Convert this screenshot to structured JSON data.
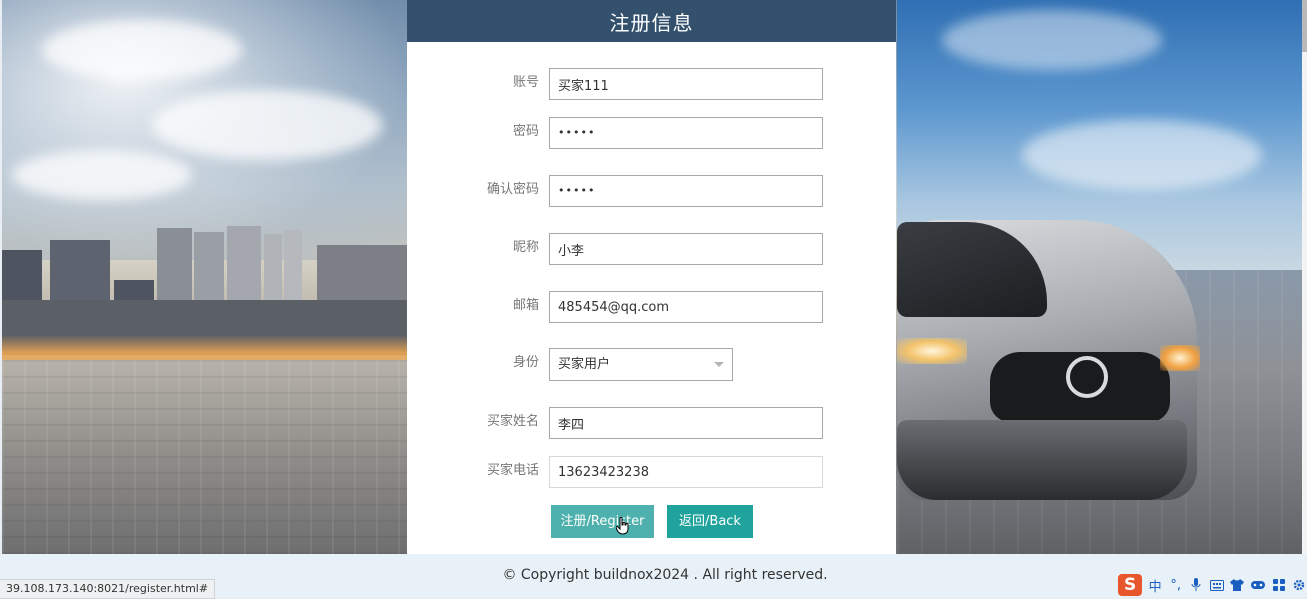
{
  "header": {
    "title": "注册信息"
  },
  "form": {
    "account": {
      "label": "账号",
      "value": "买家111"
    },
    "password": {
      "label": "密码",
      "value": "•••••"
    },
    "confirm_password": {
      "label": "确认密码",
      "value": "•••••"
    },
    "nickname": {
      "label": "昵称",
      "value": "小李"
    },
    "email": {
      "label": "邮箱",
      "value": "485454@qq.com"
    },
    "identity": {
      "label": "身份",
      "value": "买家用户"
    },
    "buyer_name": {
      "label": "买家姓名",
      "value": "李四"
    },
    "buyer_phone": {
      "label": "买家电话",
      "value": "13623423238"
    }
  },
  "buttons": {
    "register": "注册/Register",
    "back": "返回/Back"
  },
  "footer": {
    "copyright": "© Copyright buildnox2024 . All right reserved."
  },
  "status_bar": {
    "url": "39.108.173.140:8021/register.html#"
  },
  "ime": {
    "logo": "S",
    "mode": "中",
    "punct": "°,",
    "icons": [
      "microphone-icon",
      "keyboard-icon",
      "shirt-icon",
      "gamepad-icon",
      "apps-icon",
      "settings-icon"
    ]
  },
  "colors": {
    "header_bg": "#33506d",
    "register_btn": "#4fb1ad",
    "back_btn": "#1fa39c",
    "footer_bg": "#e8f1f7"
  }
}
